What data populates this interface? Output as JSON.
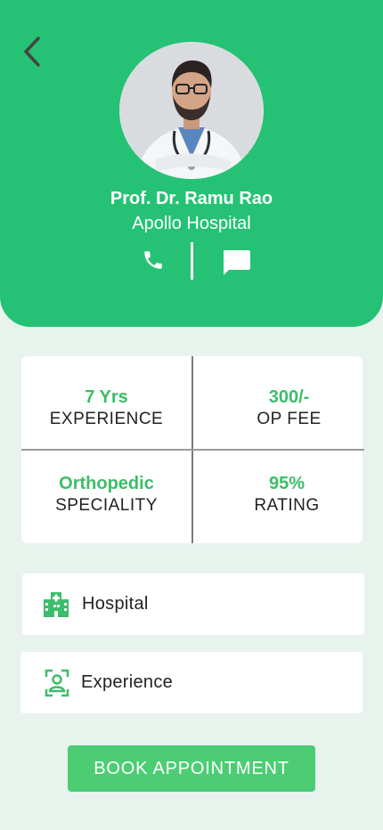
{
  "doctor": {
    "name": "Prof. Dr. Ramu Rao",
    "hospital": "Apollo Hospital"
  },
  "icons": {
    "back": "chevron-left-icon",
    "call": "phone-icon",
    "message": "chat-icon",
    "hospital": "hospital-building-icon",
    "experience": "person-scan-icon"
  },
  "stats": [
    {
      "value": "7 Yrs",
      "label": "EXPERIENCE"
    },
    {
      "value": "300/-",
      "label": "OP FEE"
    },
    {
      "value": "Orthopedic",
      "label": "SPECIALITY"
    },
    {
      "value": "95%",
      "label": "RATING"
    }
  ],
  "rows": [
    {
      "label": "Hospital"
    },
    {
      "label": "Experience"
    }
  ],
  "book_label": "BOOK APPOINTMENT",
  "colors": {
    "header": "#25c275",
    "accent": "#3cbd6a",
    "button": "#4ccd74",
    "background": "#e8f3ee"
  }
}
